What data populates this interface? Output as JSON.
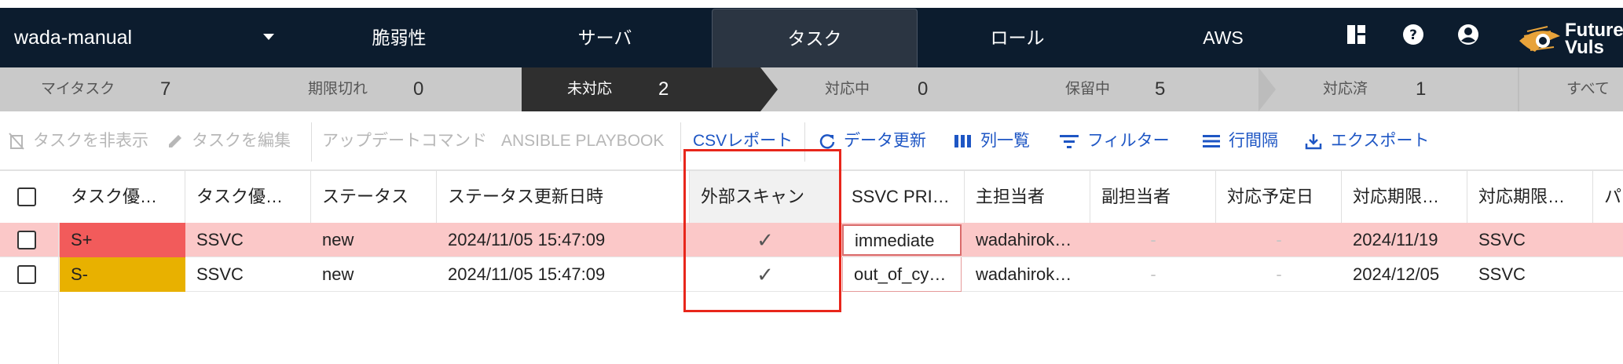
{
  "header": {
    "org": "wada-manual",
    "nav_tabs": [
      "脆弱性",
      "サーバ",
      "タスク",
      "ロール",
      "AWS"
    ],
    "active_tab": "タスク",
    "logo_line1": "Future",
    "logo_line2": "Vuls"
  },
  "status_filters": [
    {
      "label": "マイタスク",
      "count": "7"
    },
    {
      "label": "期限切れ",
      "count": "0"
    },
    {
      "label": "未対応",
      "count": "2"
    },
    {
      "label": "対応中",
      "count": "0"
    },
    {
      "label": "保留中",
      "count": "5"
    },
    {
      "label": "対応済",
      "count": "1"
    },
    {
      "label": "すべて",
      "count": ""
    }
  ],
  "active_filter": "未対応",
  "toolbar": {
    "hide_task": "タスクを非表示",
    "edit_task": "タスクを編集",
    "update_command": "アップデートコマンド",
    "ansible": "ANSIBLE PLAYBOOK",
    "csv_report": "CSVレポート",
    "refresh": "データ更新",
    "columns": "列一覧",
    "filter": "フィルター",
    "row_spacing": "行間隔",
    "export": "エクスポート"
  },
  "table": {
    "columns": [
      "タスク優…",
      "タスク優…",
      "ステータス",
      "ステータス更新日時",
      "外部スキャン",
      "SSVC PRI…",
      "主担当者",
      "副担当者",
      "対応予定日",
      "対応期限…",
      "対応期限…",
      "パ"
    ],
    "rows": [
      {
        "priority": "S+",
        "priority_color": "#f25b5b",
        "priority_type": "SSVC",
        "status": "new",
        "updated": "2024/11/05 15:47:09",
        "external_scan": "✓",
        "ssvc_priority": "immediate",
        "owner": "wadahirok…",
        "sub_owner": "-",
        "planned": "-",
        "deadline": "2024/11/19",
        "deadline_type": "SSVC"
      },
      {
        "priority": "S-",
        "priority_color": "#e8b100",
        "priority_type": "SSVC",
        "status": "new",
        "updated": "2024/11/05 15:47:09",
        "external_scan": "✓",
        "ssvc_priority": "out_of_cy…",
        "owner": "wadahirok…",
        "sub_owner": "-",
        "planned": "-",
        "deadline": "2024/12/05",
        "deadline_type": "SSVC"
      }
    ]
  },
  "colors": {
    "header_bg": "#0c1c2e",
    "status_bg": "#c9c9c9",
    "status_active_bg": "#2f2f2f",
    "link_blue": "#1e56c4",
    "row_highlight": "#fbc8c8",
    "annotation_red": "#e8261b"
  }
}
